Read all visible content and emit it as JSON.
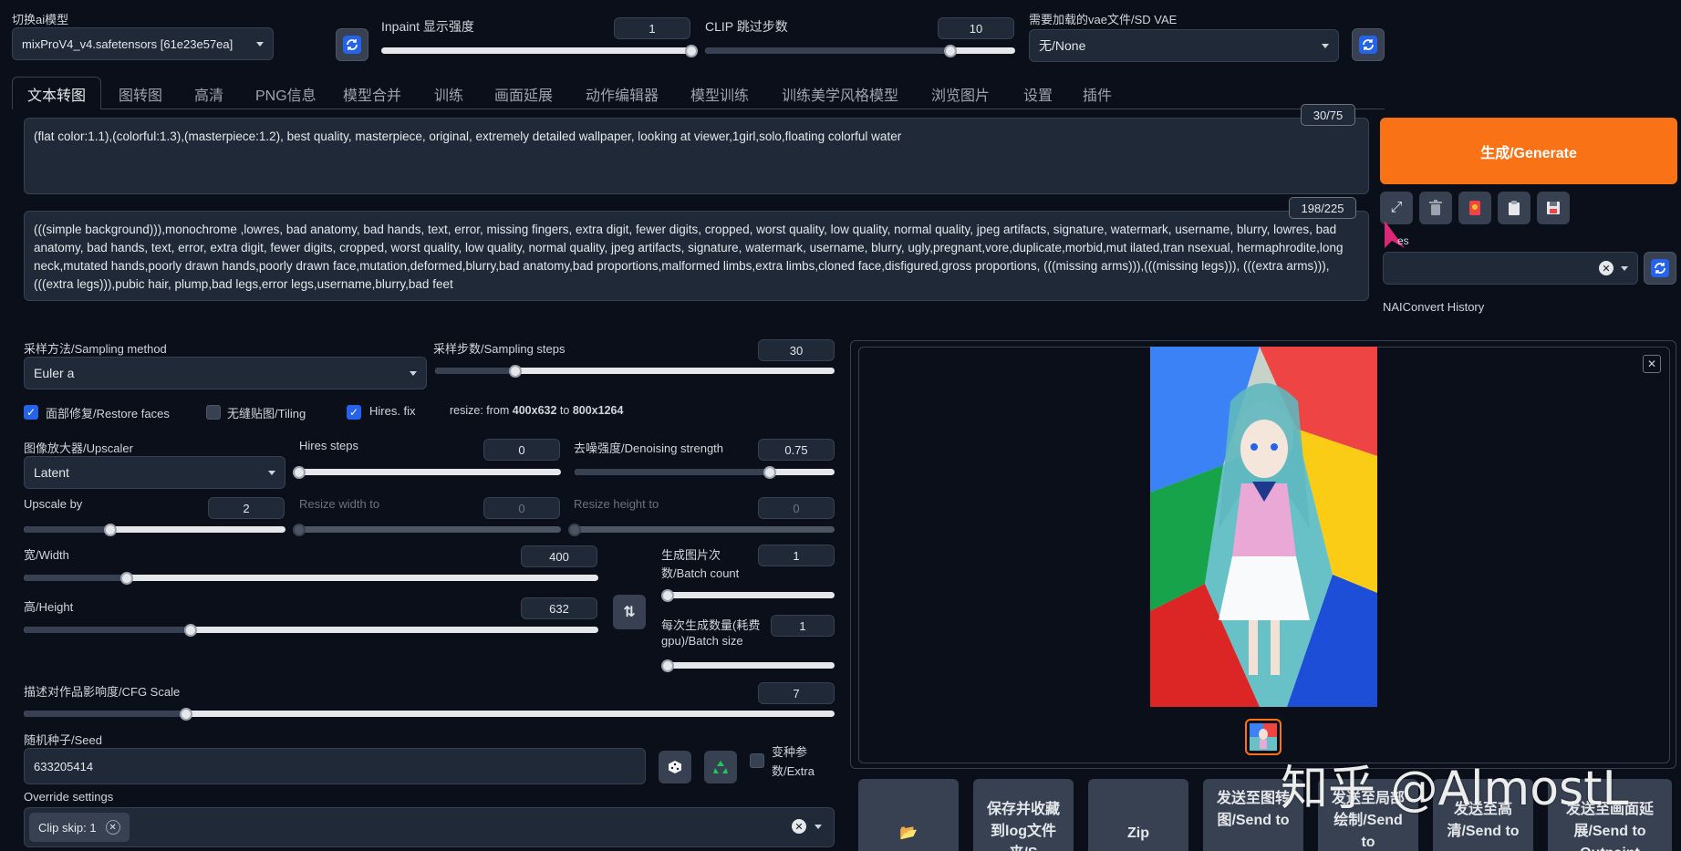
{
  "top": {
    "model_label": "切换ai模型",
    "model_value": "mixProV4_v4.safetensors [61e23e57ea]",
    "inpaint_label": "Inpaint 显示强度",
    "inpaint_value": "1",
    "clip_label": "CLIP 跳过步数",
    "clip_value": "10",
    "vae_label": "需要加载的vae文件/SD VAE",
    "vae_value": "无/None"
  },
  "tabs": [
    {
      "label": "文本转图",
      "active": true
    },
    {
      "label": "图转图"
    },
    {
      "label": "高清"
    },
    {
      "label": "PNG信息"
    },
    {
      "label": "模型合并"
    },
    {
      "label": "训练"
    },
    {
      "label": "画面延展"
    },
    {
      "label": "动作编辑器"
    },
    {
      "label": "模型训练"
    },
    {
      "label": "训练美学风格模型"
    },
    {
      "label": "浏览图片"
    },
    {
      "label": "设置"
    },
    {
      "label": "插件"
    }
  ],
  "prompt": {
    "text": "(flat color:1.1),(colorful:1.3),(masterpiece:1.2), best quality, masterpiece, original, extremely detailed wallpaper, looking at viewer,1girl,solo,floating colorful water",
    "counter": "30/75"
  },
  "negative": {
    "text": "(((simple background))),monochrome ,lowres, bad anatomy, bad hands, text, error, missing fingers, extra digit, fewer digits, cropped, worst quality, low quality, normal quality, jpeg artifacts, signature, watermark, username, blurry, lowres, bad anatomy, bad hands, text, error, extra digit, fewer digits, cropped, worst quality, low quality, normal quality, jpeg artifacts, signature, watermark, username, blurry, ugly,pregnant,vore,duplicate,morbid,mut ilated,tran nsexual, hermaphrodite,long neck,mutated hands,poorly drawn hands,poorly drawn face,mutation,deformed,blurry,bad anatomy,bad proportions,malformed limbs,extra limbs,cloned face,disfigured,gross proportions, (((missing arms))),(((missing legs))), (((extra arms))),(((extra legs))),pubic hair, plump,bad legs,error legs,username,blurry,bad feet",
    "counter": "198/225"
  },
  "generate": {
    "label": "生成/Generate",
    "color": "#f97316"
  },
  "tools": {
    "styles_label": "es",
    "nai_history": "NAIConvert History"
  },
  "sampling": {
    "method_label": "采样方法/Sampling method",
    "method_value": "Euler a",
    "steps_label": "采样步数/Sampling steps",
    "steps_value": "30",
    "steps_level": 0.2
  },
  "checks": {
    "restore_faces": {
      "label": "面部修复/Restore faces",
      "checked": true
    },
    "tiling": {
      "label": "无缝贴图/Tiling",
      "checked": false
    },
    "hires_fix": {
      "label": "Hires. fix",
      "checked": true
    },
    "resize_prefix": "resize: from ",
    "resize_from": "400x632",
    "resize_mid": " to ",
    "resize_to": "800x1264"
  },
  "hires": {
    "upscaler_label": "图像放大器/Upscaler",
    "upscaler_value": "Latent",
    "steps_label": "Hires steps",
    "steps_value": "0",
    "steps_level": 0,
    "denoise_label": "去噪强度/Denoising strength",
    "denoise_value": "0.75",
    "denoise_level": 0.75,
    "upscale_label": "Upscale by",
    "upscale_value": "2",
    "upscale_level": 0.33,
    "resize_w_label": "Resize width to",
    "resize_w_value": "0",
    "resize_h_label": "Resize height to",
    "resize_h_value": "0"
  },
  "dims": {
    "width_label": "宽/Width",
    "width_value": "400",
    "width_level": 0.18,
    "height_label": "高/Height",
    "height_value": "632",
    "height_level": 0.29,
    "batch_count_label_1": "生成图片次",
    "batch_count_label_2": "数/Batch count",
    "batch_count_value": "1",
    "batch_size_label_1": "每次生成数量(耗费",
    "batch_size_label_2": "gpu)/Batch size",
    "batch_size_value": "1"
  },
  "cfg": {
    "label": "描述对作品影响度/CFG Scale",
    "value": "7",
    "level": 0.2
  },
  "seed": {
    "label": "随机种子/Seed",
    "value": "633205414",
    "extra_label_1": "变种参",
    "extra_label_2": "数/Extra"
  },
  "override": {
    "label": "Override settings",
    "chip": "Clip skip: 1"
  },
  "output": {
    "buttons": [
      {
        "label": "📂"
      },
      {
        "label": "保存并收藏到log文件夹/S"
      },
      {
        "label": "Zip"
      },
      {
        "label": "发送至图转图/Send to"
      },
      {
        "label": "发送至局部绘制/Send to"
      },
      {
        "label": "发送至高清/Send to"
      },
      {
        "label": "发送至画面延展/Send to Outpaint"
      }
    ]
  },
  "watermark": "知乎 @AlmostL"
}
